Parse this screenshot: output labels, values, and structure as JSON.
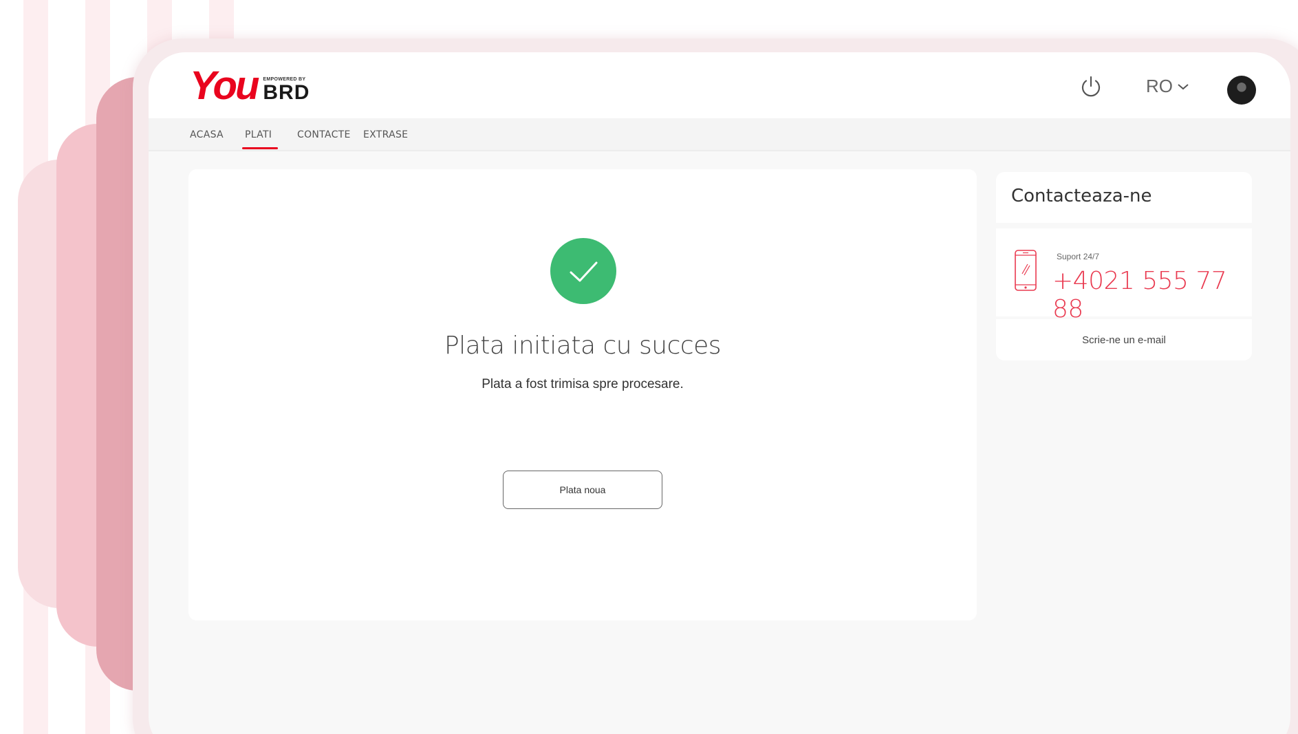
{
  "brand": {
    "logo_you": "You",
    "logo_tagline": "EMPOWERED BY",
    "logo_brd": "BRD",
    "accent_color": "#e9041e"
  },
  "header": {
    "power_icon": "power-icon",
    "language": "RO",
    "language_icon": "chevron-down-icon",
    "avatar_icon": "avatar"
  },
  "nav": {
    "items": [
      {
        "label": "ACASA"
      },
      {
        "label": "PLATI",
        "active": true
      },
      {
        "label": "CONTACTE"
      },
      {
        "label": "EXTRASE"
      }
    ]
  },
  "main": {
    "status_icon": "check-icon",
    "status_color": "#3dbb72",
    "title": "Plata initiata cu succes",
    "subtitle": "Plata a fost trimisa spre procesare.",
    "new_payment_label": "Plata noua"
  },
  "contact": {
    "title": "Contacteaza-ne",
    "support_label": "Suport 24/7",
    "phone": "+4021 555 77 88",
    "phone_color": "#e9394f",
    "email_link": "Scrie-ne un e-mail"
  }
}
